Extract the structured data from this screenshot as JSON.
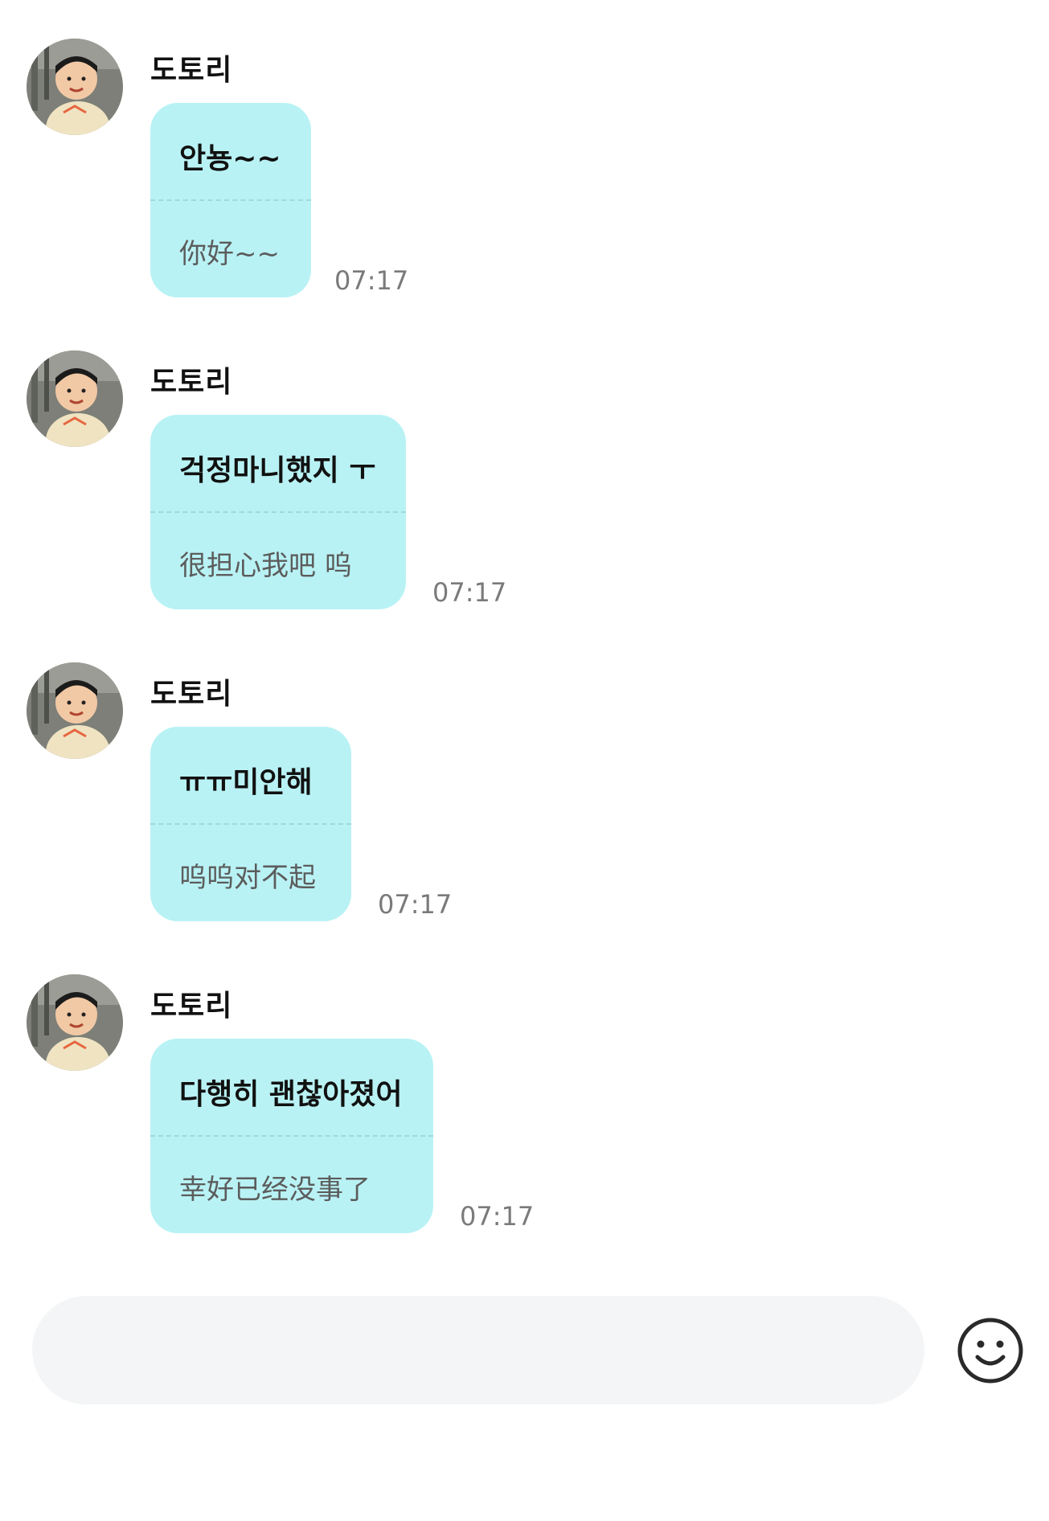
{
  "messages": [
    {
      "sender": "도토리",
      "korean": "안뇽~~",
      "chinese": "你好~~",
      "time": "07:17"
    },
    {
      "sender": "도토리",
      "korean": "걱정마니했지 ㅜ",
      "chinese": "很担心我吧 呜",
      "time": "07:17"
    },
    {
      "sender": "도토리",
      "korean": "ㅠㅠ미안해",
      "chinese": "呜呜对不起",
      "time": "07:17"
    },
    {
      "sender": "도토리",
      "korean": "다행히 괜찮아졌어",
      "chinese": "幸好已经没事了",
      "time": "07:17"
    }
  ],
  "composer": {
    "placeholder": "",
    "emoji_icon": "smiley-face-icon"
  },
  "colors": {
    "bubble": "#b9f2f4",
    "composer": "#f4f5f6",
    "time": "#7a7a7a"
  }
}
